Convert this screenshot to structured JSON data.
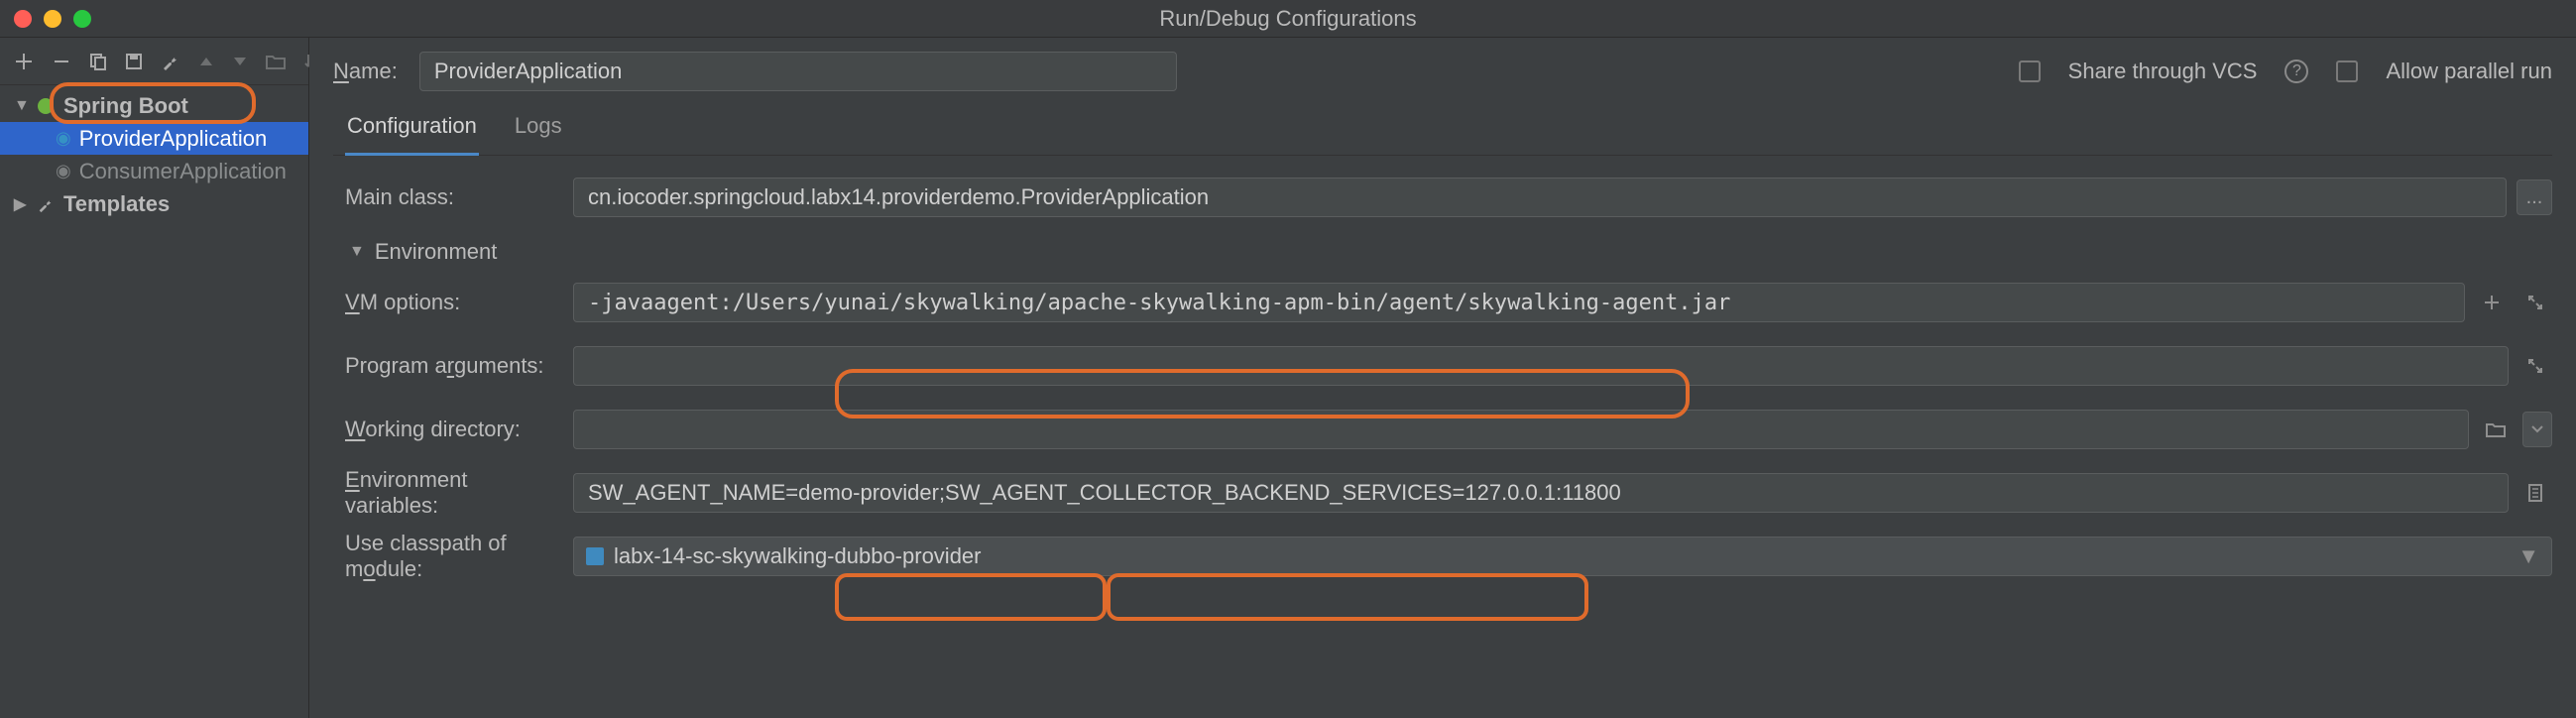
{
  "window": {
    "title": "Run/Debug Configurations"
  },
  "toolbar": {
    "add": "+",
    "remove": "−"
  },
  "tree": {
    "root1": "Spring Boot",
    "leaf1": "ProviderApplication",
    "leaf2": "ConsumerApplication",
    "root2": "Templates"
  },
  "header": {
    "name_label": "Name:",
    "name_value": "ProviderApplication",
    "share_label": "Share through VCS",
    "parallel_label": "Allow parallel run"
  },
  "tabs": {
    "configuration": "Configuration",
    "logs": "Logs"
  },
  "form": {
    "main_class_label": "Main class:",
    "main_class_value": "cn.iocoder.springcloud.labx14.providerdemo.ProviderApplication",
    "env_section": "Environment",
    "vm_label_pre": "V",
    "vm_label_post": "M options:",
    "vm_value": "-javaagent:/Users/yunai/skywalking/apache-skywalking-apm-bin/agent/skywalking-agent.jar",
    "args_label_pre": "Program a",
    "args_label_u": "r",
    "args_label_post": "guments:",
    "args_value": "",
    "wd_label_u": "W",
    "wd_label_post": "orking directory:",
    "wd_value": "",
    "env_label_u": "E",
    "env_label_post": "nvironment variables:",
    "env_value": "SW_AGENT_NAME=demo-provider;SW_AGENT_COLLECTOR_BACKEND_SERVICES=127.0.0.1:11800",
    "cp_label_pre": "Use classpath of m",
    "cp_label_u": "o",
    "cp_label_post": "dule:",
    "cp_value": "labx-14-sc-skywalking-dubbo-provider",
    "ellipsis": "..."
  }
}
